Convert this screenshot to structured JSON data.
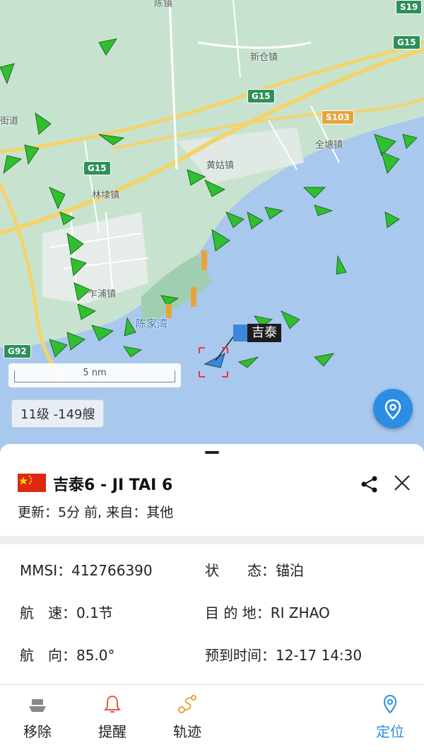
{
  "map": {
    "road_labels": {
      "g15_a": "G15",
      "g15_b": "G15",
      "g15_c": "G15",
      "s103": "S103",
      "g92": "G92",
      "s19": "S19"
    },
    "places": {
      "xincang": "新仓镇",
      "huanggu": "黄姑镇",
      "quantang": "全塘镇",
      "linli": "林埭镇",
      "zhapu": "乍浦镇",
      "chenjiawan": "陈家湾",
      "chenzhen": "陈镇",
      "jiedao": "街道"
    },
    "scale_label": "5 nm",
    "zoom_badge": "11级 -149艘",
    "selected_ship_tag": "吉泰",
    "colors": {
      "water": "#a9c8ee",
      "land": "#c7e3cf",
      "ship": "#2fbf2f",
      "accent": "#2b8de3"
    }
  },
  "vessel": {
    "title": "吉泰6 - JI TAI 6",
    "update": "更新：5分 前, 来自：其他",
    "fields": {
      "mmsi_label": "MMSI：",
      "mmsi_value": "412766390",
      "status_label": "状　　态：",
      "status_value": "锚泊",
      "speed_label": "航　速：",
      "speed_value": "0.1节",
      "dest_label": "目 的 地：",
      "dest_value": "RI ZHAO",
      "course_label": "航　向：",
      "course_value": "85.0°",
      "eta_label": "预到时间：",
      "eta_value": "12-17 14:30"
    }
  },
  "tabs": [
    {
      "label": "移除",
      "icon": "ship-remove-icon"
    },
    {
      "label": "提醒",
      "icon": "bell-icon"
    },
    {
      "label": "轨迹",
      "icon": "track-icon"
    },
    {
      "label": "定位",
      "icon": "location-pin-icon"
    }
  ]
}
